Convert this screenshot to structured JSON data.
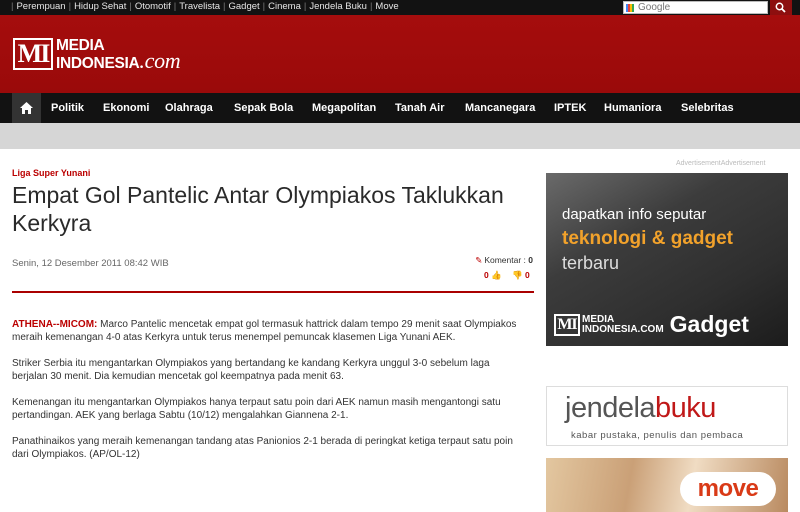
{
  "topbar": {
    "links": [
      "Perempuan",
      "Hidup Sehat",
      "Otomotif",
      "Travelista",
      "Gadget",
      "Cinema",
      "Jendela Buku",
      "Move"
    ],
    "search_placeholder": "Google"
  },
  "header": {
    "logo_mark": "MI",
    "logo_line1": "MEDIA",
    "logo_line2": "INDONESIA",
    "logo_suffix": ".com"
  },
  "nav": {
    "items": [
      "Politik",
      "Ekonomi",
      "Olahraga",
      "Sepak Bola",
      "Megapolitan",
      "Tanah Air",
      "Mancanegara",
      "IPTEK",
      "Humaniora",
      "Selebritas"
    ]
  },
  "article": {
    "kicker": "Liga Super Yunani",
    "title": "Empat Gol Pantelic Antar Olympiakos Taklukkan Kerkyra",
    "date": "Senin, 12 Desember 2011 08:42 WIB",
    "komentar_label": "Komentar :",
    "komentar_count": "0",
    "likes": "0",
    "dislikes": "0",
    "dateline": "ATHENA--MICOM:",
    "p1": " Marco Pantelic mencetak empat gol termasuk hattrick dalam tempo 29 menit saat Olympiakos meraih kemenangan 4-0 atas Kerkyra untuk terus menempel pemuncak klasemen Liga Yunani AEK.",
    "p2": "Striker Serbia itu mengantarkan Olympiakos yang bertandang ke kandang Kerkyra unggul 3-0 sebelum laga berjalan 30 menit. Dia kemudian mencetak gol keempatnya pada menit 63.",
    "p3": "Kemenangan itu mengantarkan Olympiakos hanya terpaut satu poin dari AEK namun masih mengantongi satu pertandingan. AEK yang berlaga Sabtu (10/12) mengalahkan Giannena 2-1.",
    "p4": "Panathinaikos yang meraih kemenangan tandang atas Panionios 2-1 berada di peringkat ketiga terpaut satu poin dari Olympiakos. (AP/OL-12)"
  },
  "sidebar": {
    "ad_label": "AdvertisementAdvertisement",
    "ad1": {
      "line1": "dapatkan info seputar",
      "line2": "teknologi & gadget",
      "line3": "terbaru",
      "brand_mark": "MI",
      "brand_line1": "MEDIA",
      "brand_line2": "INDONESIA.COM",
      "brand_word": "Gadget"
    },
    "ad2": {
      "word1": "jendela",
      "word2": "buku",
      "tagline": "kabar pustaka, penulis dan pembaca"
    },
    "ad3": {
      "word": "move"
    }
  }
}
